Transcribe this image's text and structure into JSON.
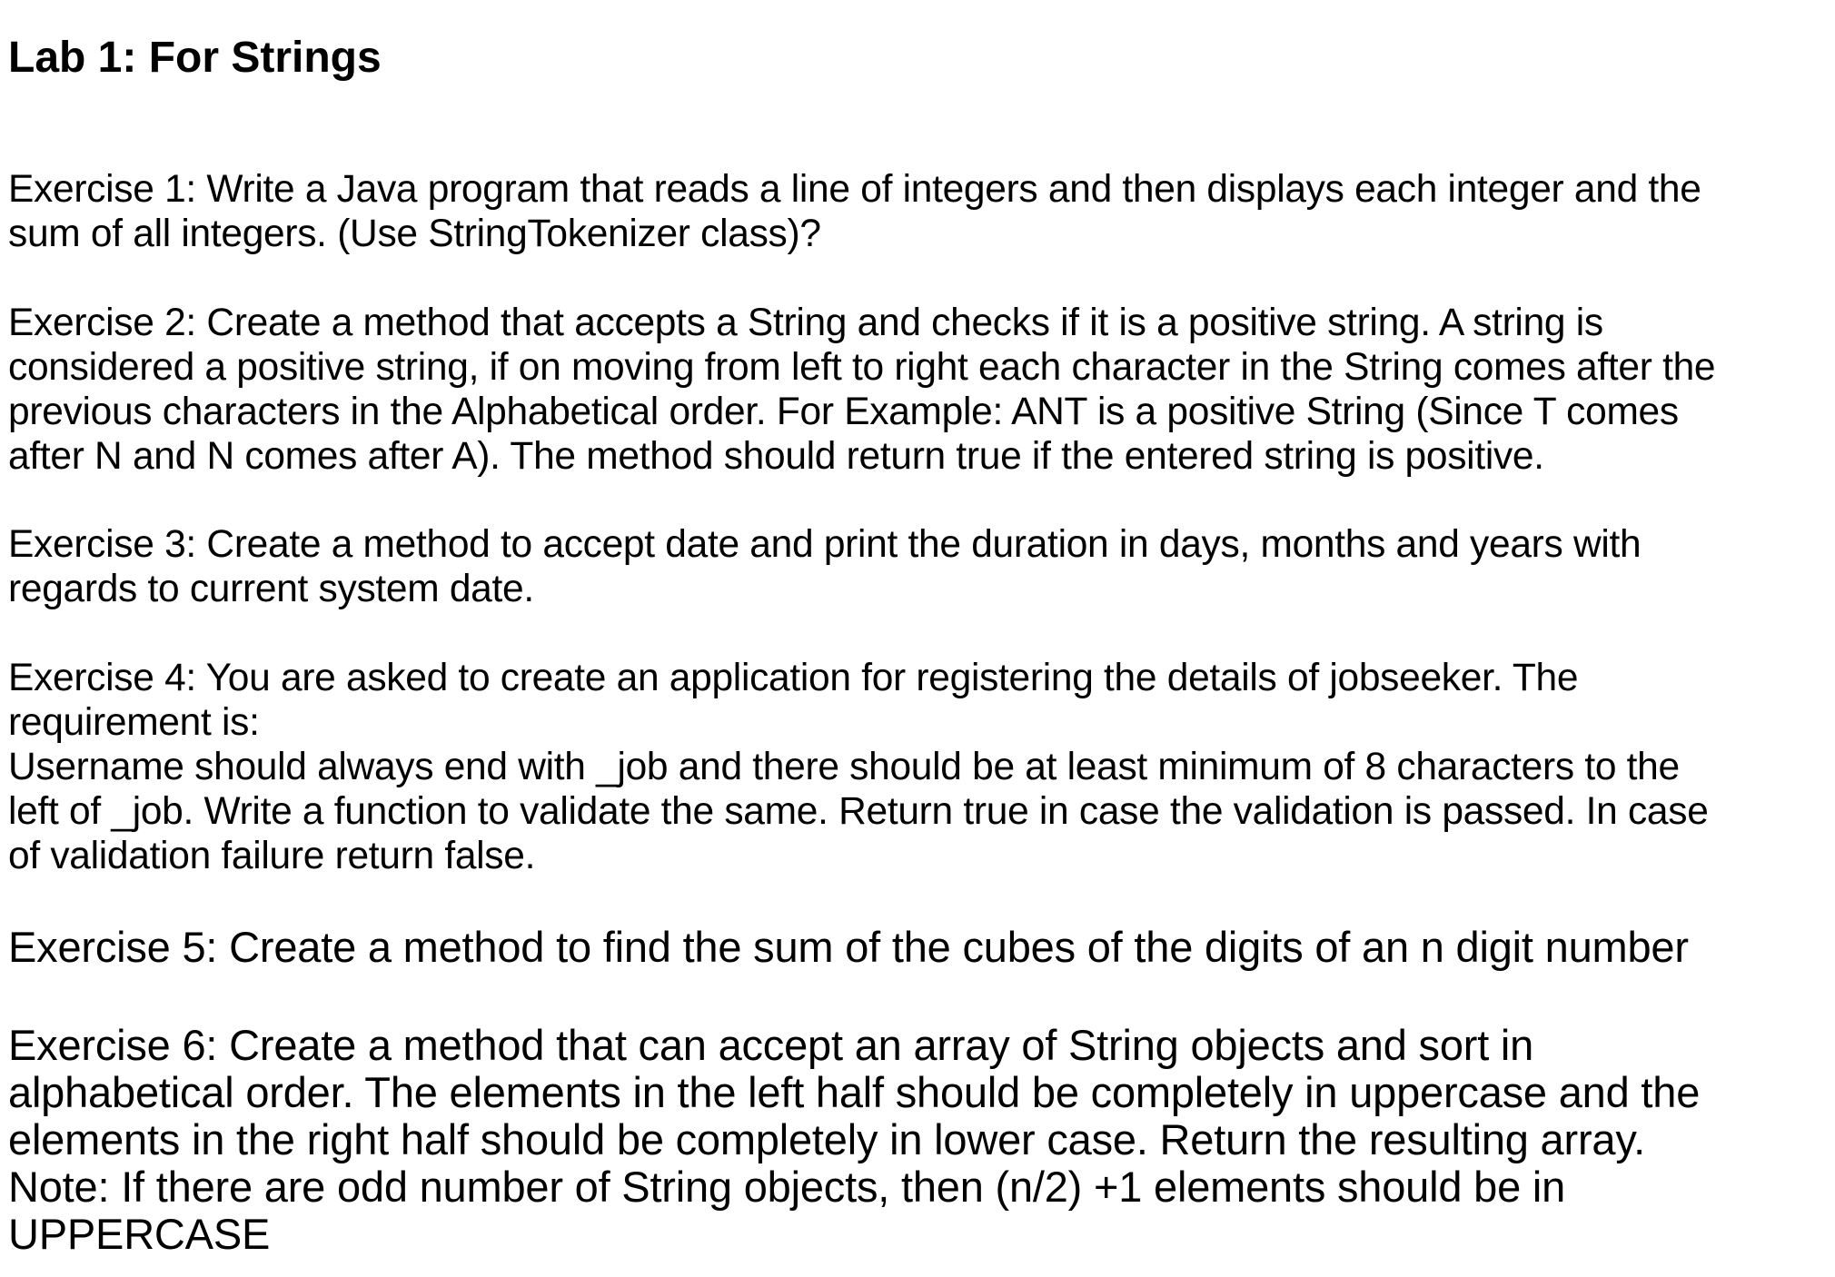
{
  "document": {
    "title": "Lab 1: For Strings",
    "exercises": [
      {
        "lines": [
          "Exercise 1: Write a Java program that reads a line of integers and then displays each integer and the",
          "sum of all integers. (Use StringTokenizer class)?"
        ]
      },
      {
        "lines": [
          "Exercise 2: Create a method that accepts a String and checks if it is a positive string. A string is",
          "considered a positive string, if on moving from left to right each character in the String comes after the",
          "previous characters in the Alphabetical order. For Example: ANT is a positive String (Since T comes",
          "after N and N comes after A). The method should return true if the entered string is positive."
        ]
      },
      {
        "lines": [
          "Exercise 3: Create a method to accept date and print the duration in days, months and years with",
          "regards to current system date."
        ]
      },
      {
        "lines": [
          "Exercise 4: You are asked to create an application for registering the details of jobseeker. The",
          "requirement is:",
          "Username should always end with _job and there should be at least minimum of 8 characters to the",
          "left of _job. Write a function to validate the same. Return true in case the validation is passed. In case",
          "of validation failure return false."
        ]
      },
      {
        "lines": [
          "Exercise 5: Create a method to find the sum of the cubes of the digits of an n digit number"
        ]
      },
      {
        "lines": [
          "Exercise 6: Create a method that can accept an array of String objects and sort in",
          "alphabetical order. The elements in the left half should be completely in uppercase and the",
          "elements in the right half should be completely in lower case. Return the resulting array.",
          "Note: If there are odd number of String objects, then (n/2) +1 elements should be in",
          "UPPERCASE"
        ]
      }
    ]
  }
}
